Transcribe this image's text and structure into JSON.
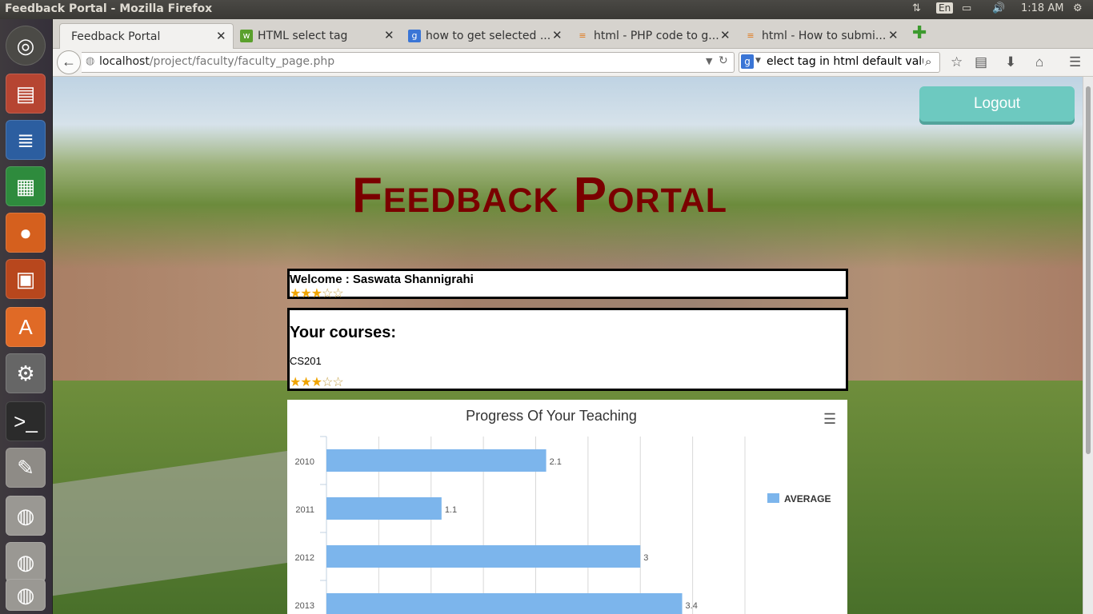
{
  "window": {
    "title": "Feedback Portal - Mozilla Firefox"
  },
  "system": {
    "lang": "En",
    "time": "1:18 AM"
  },
  "tabs": [
    {
      "label": "Feedback Portal",
      "active": true
    },
    {
      "label": "HTML select tag"
    },
    {
      "label": "how to get selected ..."
    },
    {
      "label": "html - PHP code to g..."
    },
    {
      "label": "html - How to submi..."
    }
  ],
  "navbar": {
    "url_host": "localhost",
    "url_path": "/project/faculty/faculty_page.php",
    "search_value": "elect tag in html default value"
  },
  "page": {
    "logout_label": "Logout",
    "title": "Feedback Portal",
    "welcome_text": "Welcome : Saswata Shannigrahi",
    "welcome_rating": 3,
    "courses_heading": "Your courses:",
    "course_code": "CS201",
    "course_rating": 3
  },
  "chart_data": {
    "type": "bar",
    "orientation": "horizontal",
    "title": "Progress Of Your Teaching",
    "categories": [
      "2010",
      "2011",
      "2012",
      "2013"
    ],
    "series": [
      {
        "name": "AVERAGE",
        "values": [
          2.1,
          1.1,
          3,
          3.4
        ],
        "color": "#7cb5ec"
      }
    ],
    "xlim": [
      0,
      4
    ],
    "grid": true,
    "legend_position": "right"
  }
}
